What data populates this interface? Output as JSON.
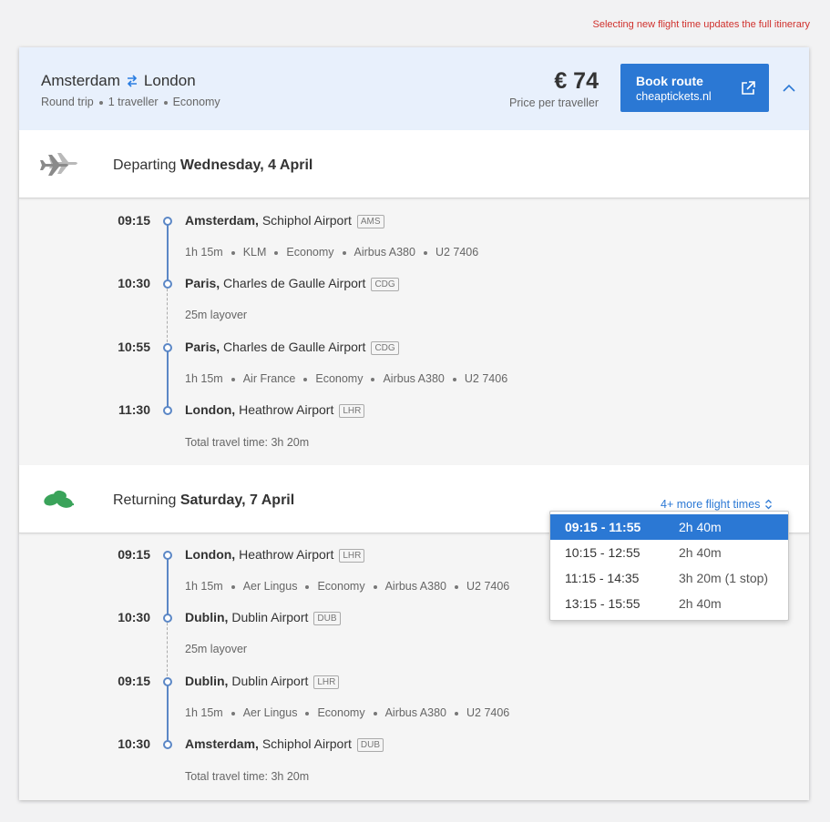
{
  "note": "Selecting new flight time updates the full itinerary",
  "header": {
    "from": "Amsterdam",
    "to": "London",
    "meta": [
      "Round trip",
      "1 traveller",
      "Economy"
    ],
    "price": "€ 74",
    "price_sub": "Price per traveller",
    "book_label": "Book route",
    "book_site": "cheaptickets.nl"
  },
  "departing": {
    "label": "Departing",
    "date": "Wednesday, 4 April",
    "stops": [
      {
        "time": "09:15",
        "city": "Amsterdam,",
        "airport": "Schiphol Airport",
        "code": "AMS"
      },
      {
        "time": "10:30",
        "city": "Paris,",
        "airport": "Charles de Gaulle Airport",
        "code": "CDG"
      },
      {
        "time": "10:55",
        "city": "Paris,",
        "airport": "Charles de Gaulle Airport",
        "code": "CDG"
      },
      {
        "time": "11:30",
        "city": "London,",
        "airport": "Heathrow Airport",
        "code": "LHR"
      }
    ],
    "flights": [
      [
        "1h 15m",
        "KLM",
        "Economy",
        "Airbus A380",
        "U2 7406"
      ],
      [
        "1h 15m",
        "Air France",
        "Economy",
        "Airbus A380",
        "U2 7406"
      ]
    ],
    "layover": "25m layover",
    "total": "Total travel time: 3h 20m"
  },
  "returning": {
    "label": "Returning",
    "date": "Saturday, 7 April",
    "more_times": "4+ more flight times",
    "stops": [
      {
        "time": "09:15",
        "city": "London,",
        "airport": "Heathrow Airport",
        "code": "LHR"
      },
      {
        "time": "10:30",
        "city": "Dublin,",
        "airport": "Dublin Airport",
        "code": "DUB"
      },
      {
        "time": "09:15",
        "city": "Dublin,",
        "airport": "Dublin Airport",
        "code": "LHR"
      },
      {
        "time": "10:30",
        "city": "Amsterdam,",
        "airport": "Schiphol Airport",
        "code": "DUB"
      }
    ],
    "flights": [
      [
        "1h 15m",
        "Aer Lingus",
        "Economy",
        "Airbus A380",
        "U2 7406"
      ],
      [
        "1h 15m",
        "Aer Lingus",
        "Economy",
        "Airbus A380",
        "U2 7406"
      ]
    ],
    "layover": "25m layover",
    "total": "Total travel time: 3h 20m"
  },
  "dropdown": [
    {
      "times": "09:15 - 11:55",
      "duration": "2h 40m",
      "selected": true
    },
    {
      "times": "10:15 - 12:55",
      "duration": "2h 40m"
    },
    {
      "times": "11:15 - 14:35",
      "duration": "3h 20m (1 stop)"
    },
    {
      "times": "13:15 - 15:55",
      "duration": "2h 40m"
    }
  ],
  "colors": {
    "accent": "#2b78d4",
    "header_bg": "#e8f0fc",
    "note": "#d0312d"
  }
}
